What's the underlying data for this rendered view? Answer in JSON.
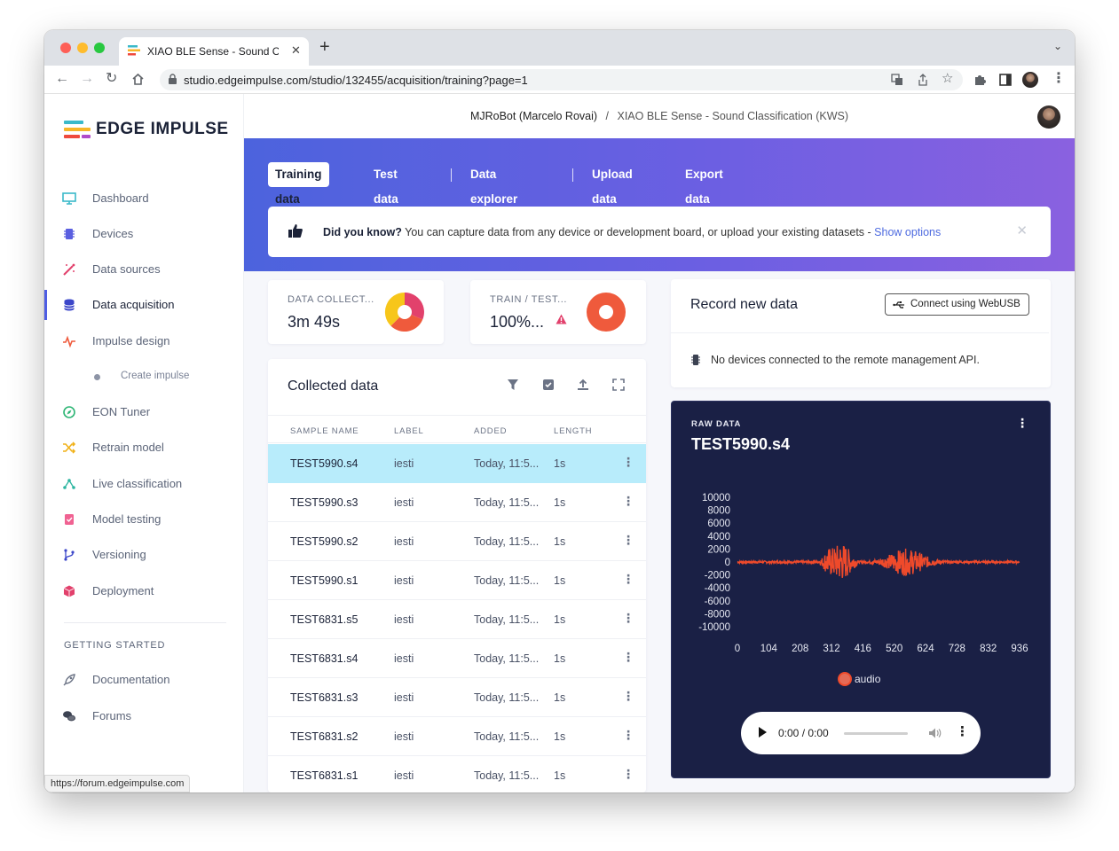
{
  "browser": {
    "tab_title": "XIAO BLE Sense - Sound Classi",
    "tab_close": "✕",
    "new_tab": "+",
    "url": "studio.edgeimpulse.com/studio/132455/acquisition/training?page=1",
    "status_url": "https://forum.edgeimpulse.com"
  },
  "sidebar": {
    "logo": "EDGE IMPULSE",
    "items": [
      {
        "label": "Dashboard"
      },
      {
        "label": "Devices"
      },
      {
        "label": "Data sources"
      },
      {
        "label": "Data acquisition"
      },
      {
        "label": "Impulse design"
      },
      {
        "label": "Create impulse"
      },
      {
        "label": "EON Tuner"
      },
      {
        "label": "Retrain model"
      },
      {
        "label": "Live classification"
      },
      {
        "label": "Model testing"
      },
      {
        "label": "Versioning"
      },
      {
        "label": "Deployment"
      }
    ],
    "section_title": "GETTING STARTED",
    "help": [
      {
        "label": "Documentation"
      },
      {
        "label": "Forums"
      }
    ]
  },
  "header": {
    "owner": "MJRoBot (Marcelo Rovai)",
    "separator": "/",
    "project": "XIAO BLE Sense - Sound Classification (KWS)"
  },
  "tabs": [
    "Training data",
    "Test data",
    "Data explorer",
    "Upload data",
    "Export data"
  ],
  "tip": {
    "bold": "Did you know?",
    "text": " You can capture data from any device or development board, or upload your existing datasets - ",
    "link": "Show options",
    "close": "✕"
  },
  "stats": {
    "collected_label": "DATA COLLECT...",
    "collected_value": "3m 49s",
    "split_label": "TRAIN / TEST...",
    "split_value": "100%..."
  },
  "collected": {
    "title": "Collected data",
    "columns": [
      "SAMPLE NAME",
      "LABEL",
      "ADDED",
      "LENGTH"
    ],
    "rows": [
      {
        "name": "TEST5990.s4",
        "label": "iesti",
        "added": "Today, 11:5...",
        "length": "1s"
      },
      {
        "name": "TEST5990.s3",
        "label": "iesti",
        "added": "Today, 11:5...",
        "length": "1s"
      },
      {
        "name": "TEST5990.s2",
        "label": "iesti",
        "added": "Today, 11:5...",
        "length": "1s"
      },
      {
        "name": "TEST5990.s1",
        "label": "iesti",
        "added": "Today, 11:5...",
        "length": "1s"
      },
      {
        "name": "TEST6831.s5",
        "label": "iesti",
        "added": "Today, 11:5...",
        "length": "1s"
      },
      {
        "name": "TEST6831.s4",
        "label": "iesti",
        "added": "Today, 11:5...",
        "length": "1s"
      },
      {
        "name": "TEST6831.s3",
        "label": "iesti",
        "added": "Today, 11:5...",
        "length": "1s"
      },
      {
        "name": "TEST6831.s2",
        "label": "iesti",
        "added": "Today, 11:5...",
        "length": "1s"
      },
      {
        "name": "TEST6831.s1",
        "label": "iesti",
        "added": "Today, 11:5...",
        "length": "1s"
      }
    ],
    "row_menu": "⋮"
  },
  "record": {
    "title": "Record new data",
    "webusb_label": "Connect using WebUSB",
    "no_devices": "No devices connected to the remote management API."
  },
  "raw": {
    "label": "RAW DATA",
    "sample": "TEST5990.s4",
    "menu": "⋮"
  },
  "chart_data": {
    "type": "line",
    "series": [
      {
        "name": "audio",
        "color": "#ef4a2b"
      }
    ],
    "x_ticks": [
      0,
      104,
      208,
      312,
      416,
      520,
      624,
      728,
      832,
      936
    ],
    "y_ticks": [
      10000,
      8000,
      6000,
      4000,
      2000,
      0,
      -2000,
      -4000,
      -6000,
      -8000,
      -10000
    ],
    "xlim": [
      0,
      936
    ],
    "ylim": [
      -10000,
      10000
    ],
    "grid": false,
    "legend": "bottom"
  },
  "player": {
    "time": "0:00 / 0:00",
    "menu": "⋮"
  },
  "colors": {
    "accent": "#4e5de3",
    "selected_row": "#b8ecfb",
    "raw_bg": "#1a2045",
    "waveform": "#ef4a2b"
  }
}
